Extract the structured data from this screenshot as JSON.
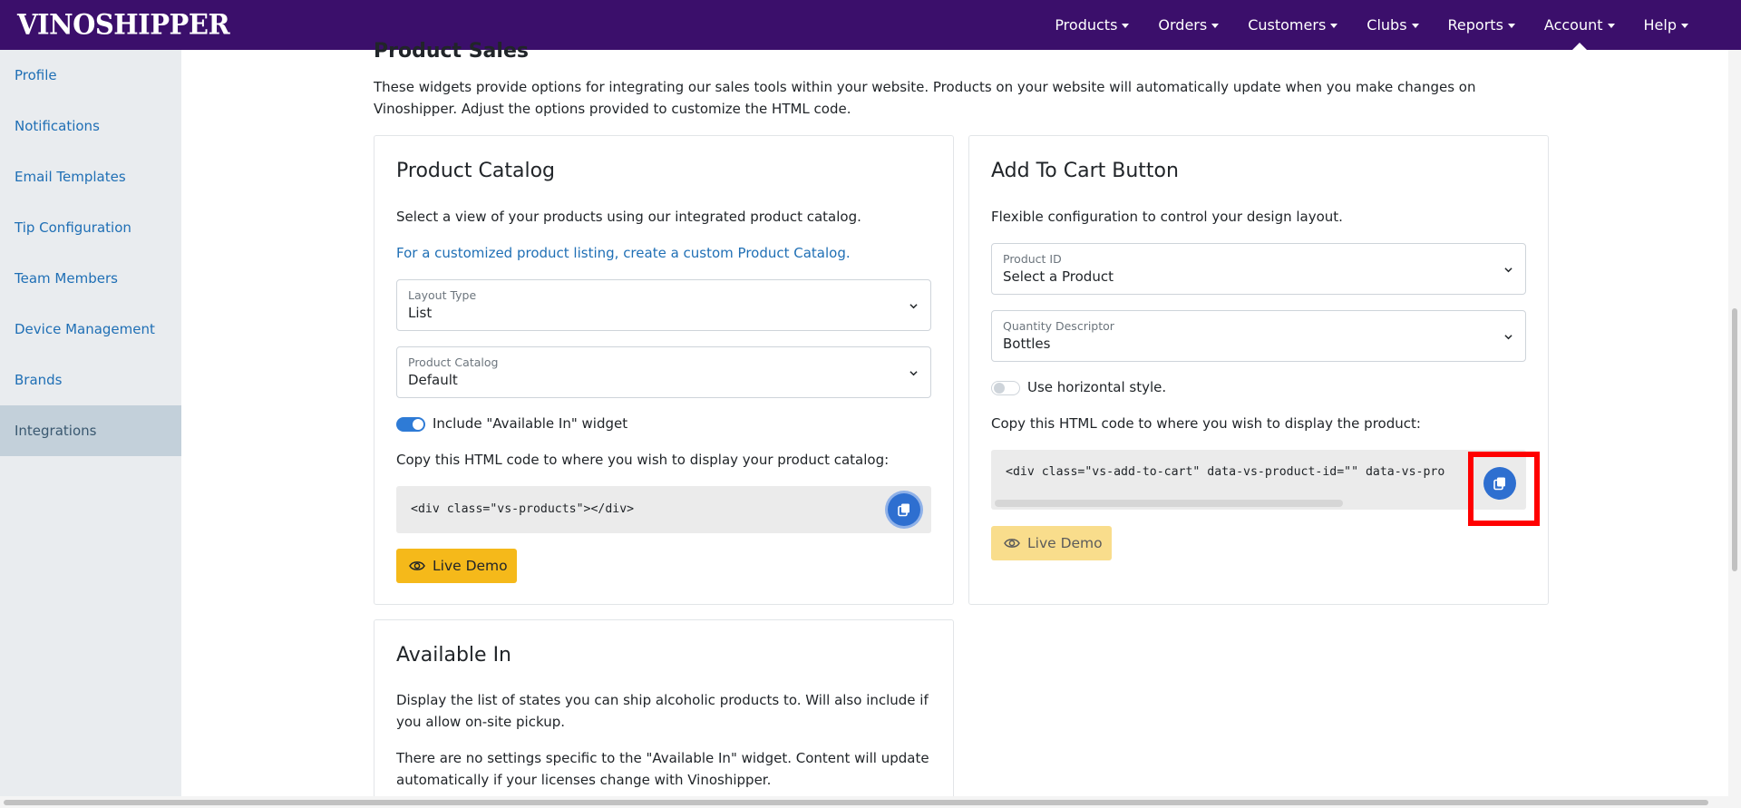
{
  "logo": "VINOSHIPPER",
  "nav": [
    {
      "label": "Products"
    },
    {
      "label": "Orders"
    },
    {
      "label": "Customers"
    },
    {
      "label": "Clubs"
    },
    {
      "label": "Reports"
    },
    {
      "label": "Account"
    },
    {
      "label": "Help"
    }
  ],
  "sidebar": {
    "items": [
      {
        "label": "Profile"
      },
      {
        "label": "Notifications"
      },
      {
        "label": "Email Templates"
      },
      {
        "label": "Tip Configuration"
      },
      {
        "label": "Team Members"
      },
      {
        "label": "Device Management"
      },
      {
        "label": "Brands"
      },
      {
        "label": "Integrations"
      }
    ]
  },
  "main": {
    "title": "Product Sales",
    "intro": "These widgets provide options for integrating our sales tools within your website. Products on your website will automatically update when you make changes on Vinoshipper. Adjust the options provided to customize the HTML code."
  },
  "catalog": {
    "title": "Product Catalog",
    "description": "Select a view of your products using our integrated product catalog.",
    "link": "For a customized product listing, create a custom Product Catalog.",
    "layout_type": {
      "label": "Layout Type",
      "value": "List"
    },
    "product_catalog": {
      "label": "Product Catalog",
      "value": "Default"
    },
    "toggle_label": "Include \"Available In\" widget",
    "copy_instructions": "Copy this HTML code to where you wish to display your product catalog:",
    "code": "<div class=\"vs-products\"></div>",
    "demo_label": "Live Demo"
  },
  "cart": {
    "title": "Add To Cart Button",
    "description": "Flexible configuration to control your design layout.",
    "product_id": {
      "label": "Product ID",
      "value": "Select a Product"
    },
    "quantity_descriptor": {
      "label": "Quantity Descriptor",
      "value": "Bottles"
    },
    "toggle_label": "Use horizontal style.",
    "copy_instructions": "Copy this HTML code to where you wish to display the product:",
    "code": "<div class=\"vs-add-to-cart\" data-vs-product-id=\"\" data-vs-pro",
    "demo_label": "Live Demo"
  },
  "available": {
    "title": "Available In",
    "description": "Display the list of states you can ship alcoholic products to. Will also include if you allow on-site pickup.",
    "note": "There are no settings specific to the \"Available In\" widget. Content will update automatically if your licenses change with Vinoshipper."
  },
  "colors": {
    "nav_bg": "#3b0f6b",
    "accent": "#2e6fd0",
    "link": "#1f6fb5",
    "demo_button": "#f5b91a",
    "highlight": "#ff0000"
  }
}
